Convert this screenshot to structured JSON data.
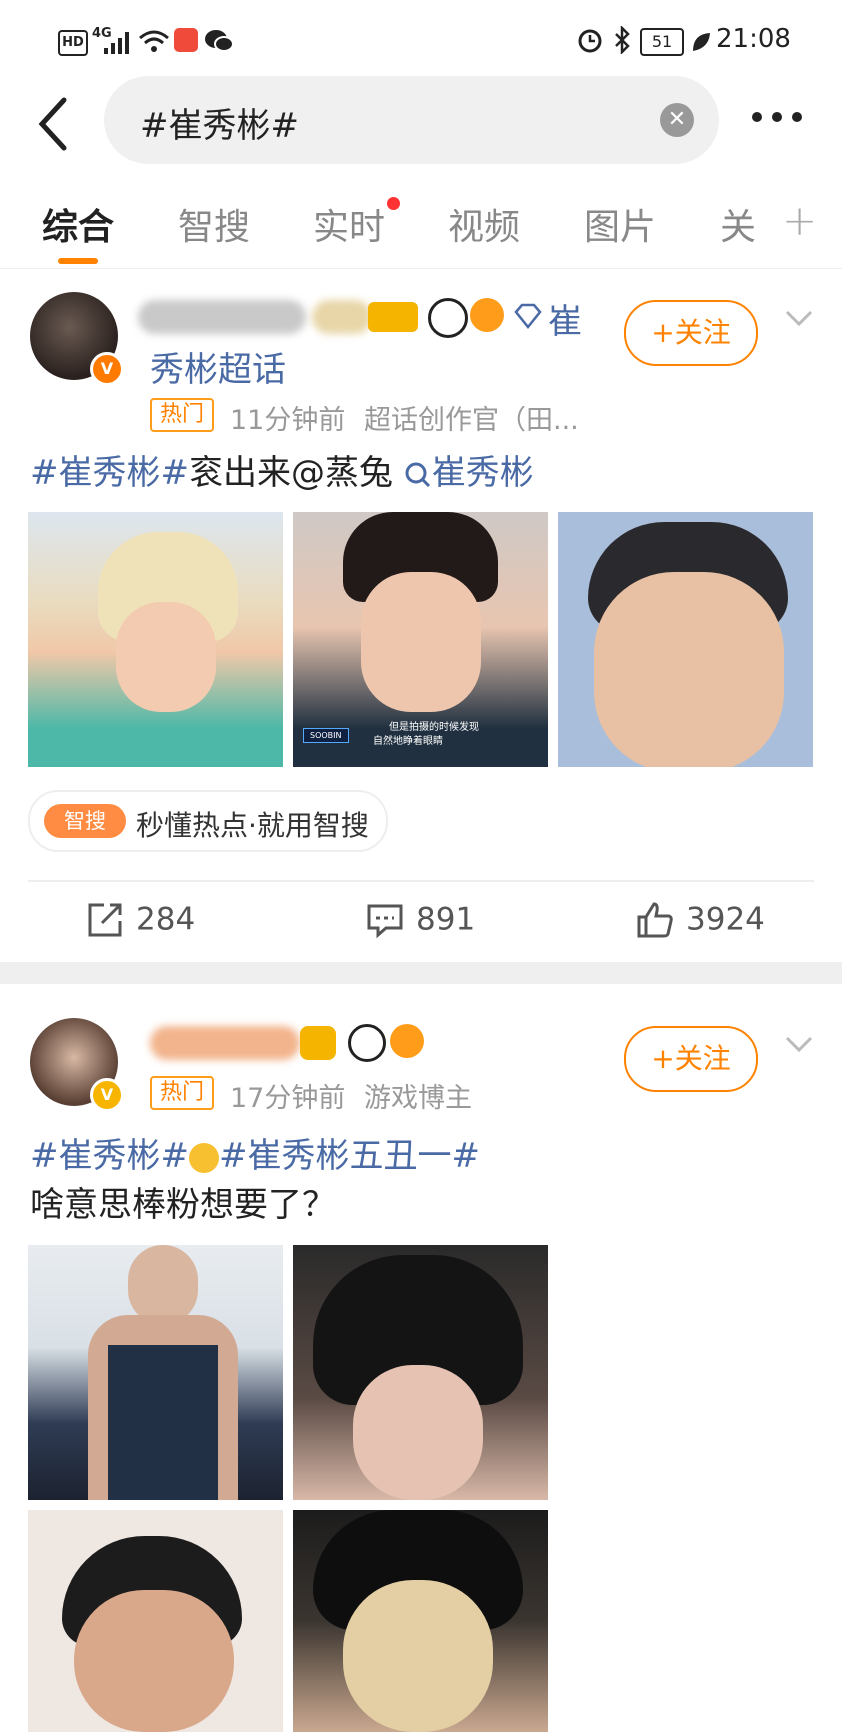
{
  "status_bar": {
    "hd": "HD",
    "network": "4G",
    "battery": "51",
    "time": "21:08"
  },
  "search": {
    "query": "#崔秀彬#"
  },
  "tabs": [
    {
      "label": "综合"
    },
    {
      "label": "智搜"
    },
    {
      "label": "实时"
    },
    {
      "label": "视频"
    },
    {
      "label": "图片"
    },
    {
      "label": "关"
    }
  ],
  "posts": [
    {
      "name_tail": "崔",
      "name_line2": "秀彬超话",
      "hot": "热门",
      "time": "11分钟前",
      "source": "超话创作官（田...",
      "follow": "+关注",
      "text_topic": "#崔秀彬#",
      "text_body": "衮出来@蒸兔",
      "text_search": "崔秀彬",
      "zhisou_tag": "智搜",
      "zhisou_text": "秒懂热点·就用智搜",
      "reposts": "284",
      "comments": "891",
      "likes": "3924",
      "image2_caption1": "但是拍摄的时候发现",
      "image2_caption2": "自然地睁着眼睛",
      "image2_name": "SOOBIN"
    },
    {
      "hot": "热门",
      "time": "17分钟前",
      "source": "游戏博主",
      "follow": "+关注",
      "text_topic1": "#崔秀彬#",
      "text_topic2": "#崔秀彬五丑一#",
      "text_line2": "啥意思棒粉想要了？"
    }
  ],
  "colors": {
    "accent": "#ff8200",
    "topic": "#4a6aa5",
    "text": "#222222",
    "meta": "#999999"
  }
}
